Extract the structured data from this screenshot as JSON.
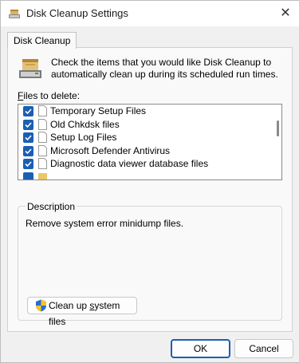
{
  "window": {
    "title": "Disk Cleanup Settings",
    "close_glyph": "✕"
  },
  "tab": {
    "label": "Disk Cleanup"
  },
  "header": {
    "icon": "disk-cleanup-icon",
    "text": "Check the items that you would like Disk Cleanup to automatically clean up during its scheduled run times."
  },
  "files": {
    "label_accel": "F",
    "label_rest": "iles to delete:",
    "items": [
      {
        "label": "Temporary Setup Files",
        "checked": true
      },
      {
        "label": "Old Chkdsk files",
        "checked": true
      },
      {
        "label": "Setup Log Files",
        "checked": true
      },
      {
        "label": "Microsoft Defender Antivirus",
        "checked": true
      },
      {
        "label": "Diagnostic data viewer database files",
        "checked": true
      }
    ]
  },
  "description": {
    "title": "Description",
    "text": "Remove system error minidump files."
  },
  "buttons": {
    "cleanup_pre": "Clean up ",
    "cleanup_accel": "s",
    "cleanup_post": "ystem files",
    "ok": "OK",
    "cancel": "Cancel"
  },
  "colors": {
    "accent": "#1a5fb4",
    "background": "#f0f0f0"
  }
}
